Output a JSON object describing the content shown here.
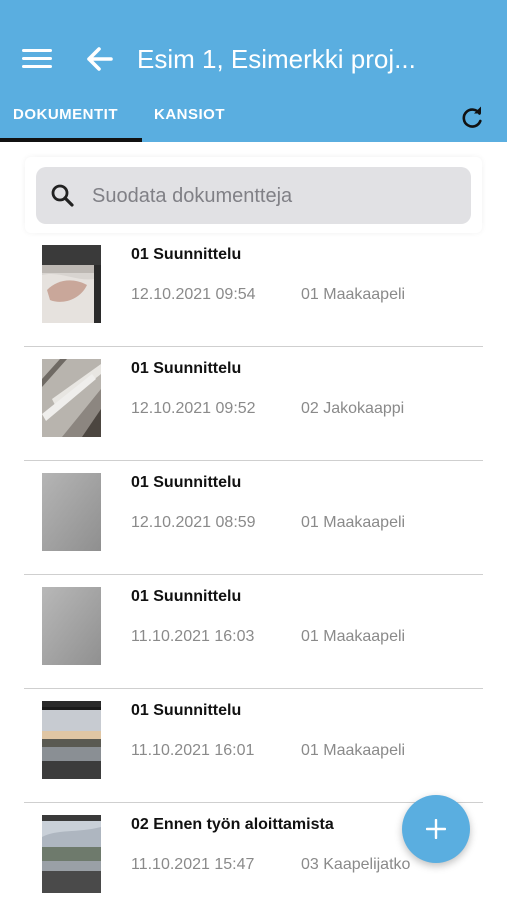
{
  "header": {
    "title": "Esim 1, Esimerkki proj...",
    "background_color": "#5aaee0",
    "menu_icon": "hamburger-menu-icon",
    "back_icon": "arrow-left-icon",
    "refresh_icon": "refresh-icon"
  },
  "tabs": [
    {
      "label": "DOKUMENTIT",
      "active": true
    },
    {
      "label": "KANSIOT",
      "active": false
    }
  ],
  "search": {
    "placeholder": "Suodata dokumentteja",
    "value": "",
    "icon": "search-icon"
  },
  "documents": [
    {
      "title": "01 Suunnittelu",
      "date": "12.10.2021 09:54",
      "folder": "01 Maakaapeli",
      "thumbnail": "photo-cable-on-floor"
    },
    {
      "title": "01 Suunnittelu",
      "date": "12.10.2021 09:52",
      "folder": "02 Jakokaappi",
      "thumbnail": "photo-window-frame"
    },
    {
      "title": "01 Suunnittelu",
      "date": "12.10.2021 08:59",
      "folder": "01 Maakaapeli",
      "thumbnail": "photo-gray-blur"
    },
    {
      "title": "01 Suunnittelu",
      "date": "11.10.2021 16:03",
      "folder": "01 Maakaapeli",
      "thumbnail": "photo-gray-blur"
    },
    {
      "title": "01 Suunnittelu",
      "date": "11.10.2021 16:01",
      "folder": "01 Maakaapeli",
      "thumbnail": "photo-sunset-window"
    },
    {
      "title": "02 Ennen työn aloittamista",
      "date": "11.10.2021 15:47",
      "folder": "03 Kaapelijatko",
      "thumbnail": "photo-landscape-window"
    }
  ],
  "fab": {
    "icon": "plus-icon",
    "color": "#5aaee0"
  }
}
